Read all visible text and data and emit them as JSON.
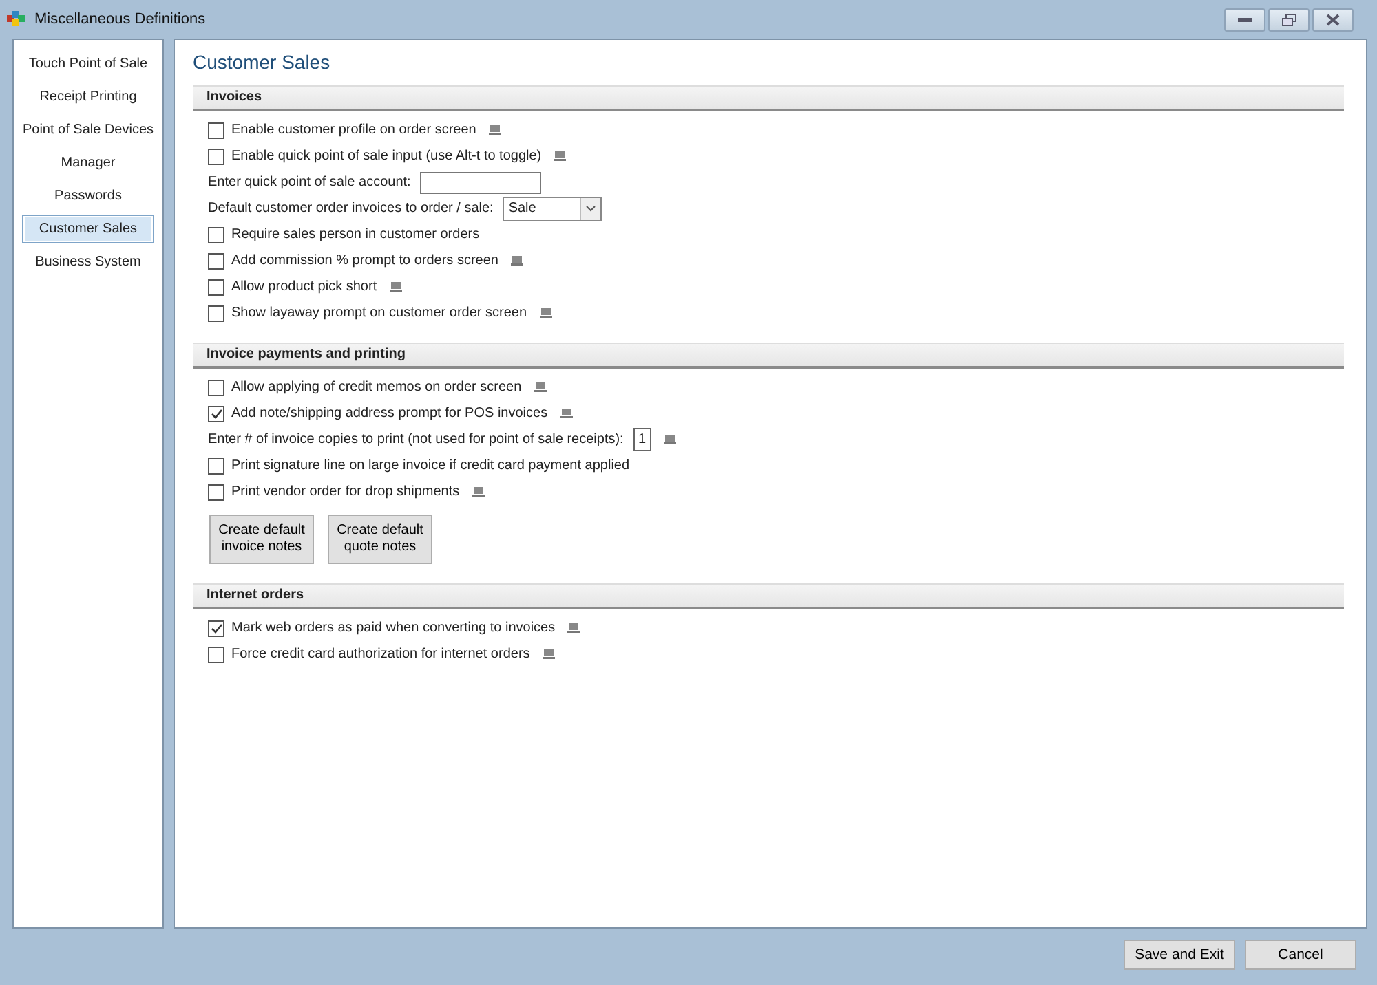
{
  "window": {
    "title": "Miscellaneous Definitions"
  },
  "sidebar": {
    "items": [
      {
        "label": "Touch Point of Sale",
        "selected": false
      },
      {
        "label": "Receipt Printing",
        "selected": false
      },
      {
        "label": "Point of Sale Devices",
        "selected": false
      },
      {
        "label": "Manager",
        "selected": false
      },
      {
        "label": "Passwords",
        "selected": false
      },
      {
        "label": "Customer Sales",
        "selected": true
      },
      {
        "label": "Business System",
        "selected": false
      }
    ]
  },
  "page_title": "Customer Sales",
  "sections": [
    {
      "title": "Invoices",
      "rows": [
        {
          "kind": "checkbox",
          "label": "Enable customer profile on order screen",
          "checked": false,
          "note_icon": true
        },
        {
          "kind": "checkbox",
          "label": "Enable quick point of sale input (use Alt-t to toggle)",
          "checked": false,
          "note_icon": true
        },
        {
          "kind": "text_input",
          "label": "Enter quick point of sale account:",
          "note_icon": false
        },
        {
          "kind": "dropdown",
          "label": "Default customer order invoices to order / sale:",
          "value": "Sale",
          "note_icon": false
        },
        {
          "kind": "checkbox",
          "label": "Require sales person in customer orders",
          "checked": false,
          "note_icon": false
        },
        {
          "kind": "checkbox",
          "label": "Add commission % prompt to orders screen",
          "checked": false,
          "note_icon": true
        },
        {
          "kind": "checkbox",
          "label": "Allow product pick short",
          "checked": false,
          "note_icon": true
        },
        {
          "kind": "checkbox",
          "label": "Show layaway prompt on customer order screen",
          "checked": false,
          "note_icon": true
        }
      ]
    },
    {
      "title": "Invoice payments and printing",
      "rows": [
        {
          "kind": "checkbox",
          "label": "Allow applying of credit memos on order screen",
          "checked": false,
          "note_icon": true
        },
        {
          "kind": "checkbox",
          "label": "Add note/shipping address prompt for POS invoices",
          "checked": true,
          "note_icon": true
        },
        {
          "kind": "number_input",
          "label": "Enter # of invoice copies to print (not used for point of sale receipts):",
          "value": "1",
          "note_icon": true
        },
        {
          "kind": "checkbox",
          "label": "Print signature line on large invoice if credit card payment applied",
          "checked": false,
          "note_icon": false
        },
        {
          "kind": "checkbox",
          "label": "Print vendor order for drop shipments",
          "checked": false,
          "note_icon": true
        },
        {
          "kind": "buttons",
          "buttons": [
            "Create default invoice notes",
            "Create default quote notes"
          ]
        }
      ]
    },
    {
      "title": "Internet orders",
      "rows": [
        {
          "kind": "checkbox",
          "label": "Mark web orders as paid when converting to invoices",
          "checked": true,
          "note_icon": true
        },
        {
          "kind": "checkbox",
          "label": "Force credit card authorization for internet orders",
          "checked": false,
          "note_icon": true
        }
      ]
    }
  ],
  "footer_buttons": [
    "Save and Exit",
    "Cancel"
  ]
}
